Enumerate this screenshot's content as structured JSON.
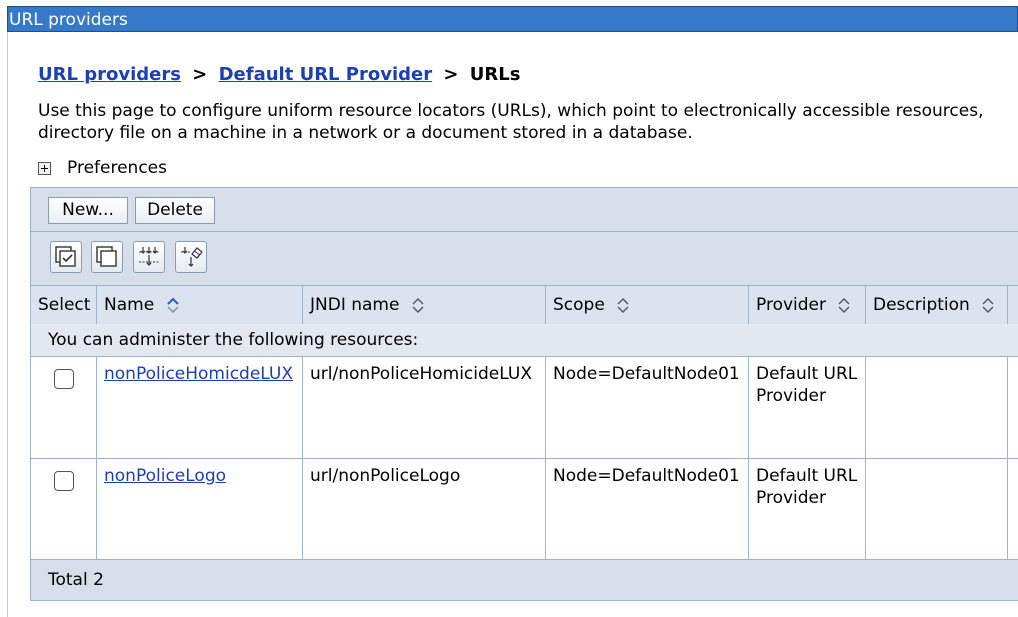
{
  "window": {
    "title": "URL providers"
  },
  "breadcrumb": {
    "items": [
      "URL providers",
      "Default URL Provider"
    ],
    "separator": ">",
    "current": "URLs"
  },
  "description": {
    "line1": "Use this page to configure uniform resource locators (URLs), which point to electronically accessible resources,",
    "line2": "directory file on a machine in a network or a document stored in a database."
  },
  "preferences": {
    "label": "Preferences"
  },
  "toolbar": {
    "new_label": "New...",
    "delete_label": "Delete"
  },
  "icons": [
    "select-all-icon",
    "deselect-all-icon",
    "show-filter-icon",
    "clear-filter-icon"
  ],
  "table": {
    "headers": [
      "Select",
      "Name",
      "JNDI name",
      "Scope",
      "Provider",
      "Description"
    ],
    "info": "You can administer the following resources:",
    "rows": [
      {
        "name": "nonPoliceHomicdeLUX",
        "jndi": "url/nonPoliceHomicideLUX",
        "scope": "Node=DefaultNode01",
        "provider": "Default URL Provider",
        "description": ""
      },
      {
        "name": "nonPoliceLogo",
        "jndi": "url/nonPoliceLogo",
        "scope": "Node=DefaultNode01",
        "provider": "Default URL Provider",
        "description": ""
      }
    ],
    "total": "Total 2"
  },
  "colors": {
    "titlebar": "#3579c8",
    "link": "#1d3fb4",
    "panel": "#d6deea"
  }
}
